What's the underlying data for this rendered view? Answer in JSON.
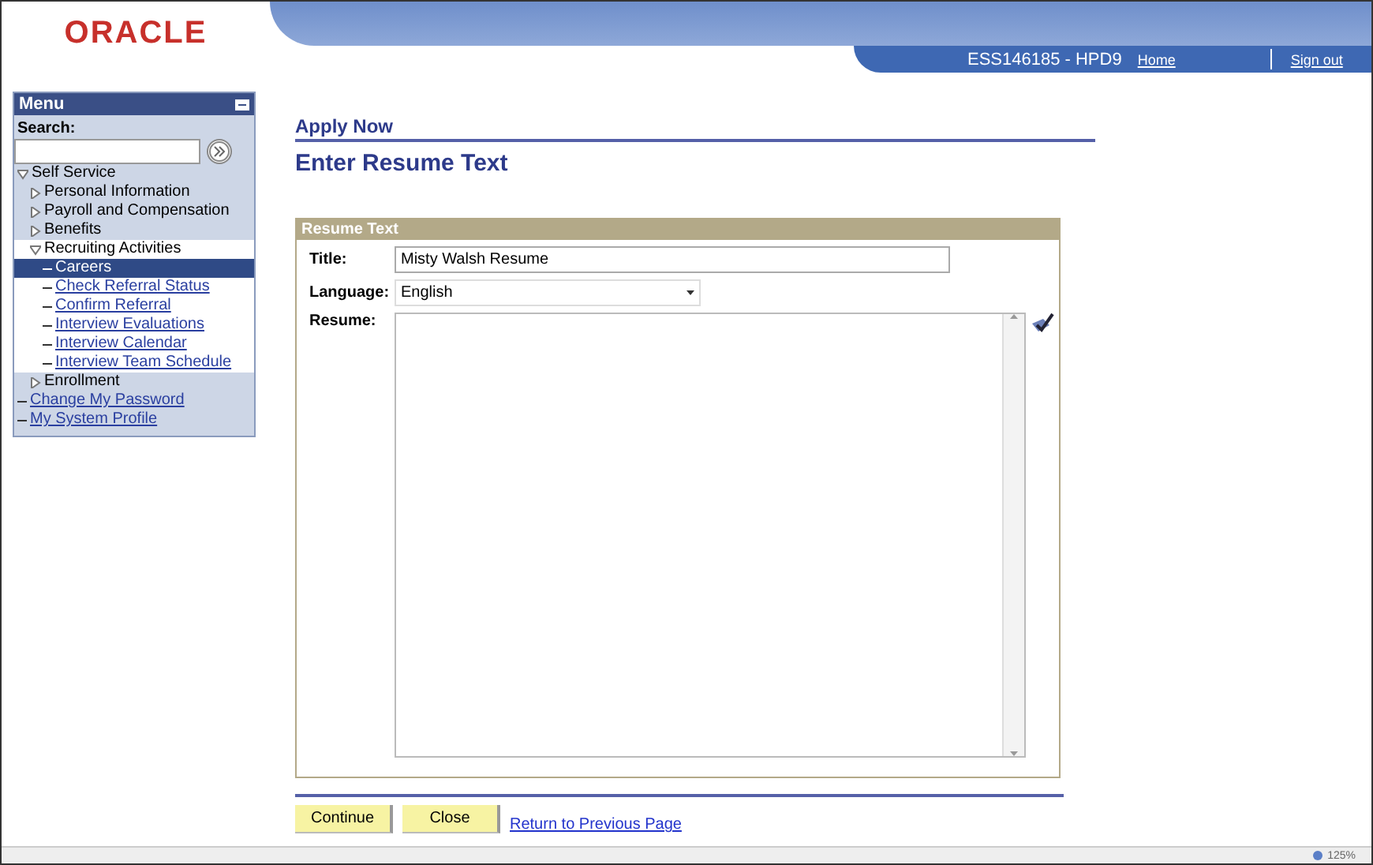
{
  "header": {
    "logo": "ORACLE",
    "server": "ESS146185 - HPD9",
    "links": [
      "Home",
      "Sign out"
    ]
  },
  "menu": {
    "title": "Menu",
    "search_label": "Search:",
    "items": [
      {
        "label": "Self Service",
        "kind": "folder",
        "expanded": true,
        "children": [
          {
            "label": "Personal Information",
            "kind": "folder",
            "expanded": false
          },
          {
            "label": "Payroll and Compensation",
            "kind": "folder",
            "expanded": false
          },
          {
            "label": "Benefits",
            "kind": "folder",
            "expanded": false
          },
          {
            "label": "Recruiting Activities",
            "kind": "folder",
            "expanded": true,
            "children": [
              {
                "label": "Careers",
                "kind": "link",
                "selected": true
              },
              {
                "label": "Check Referral Status",
                "kind": "link",
                "selected": false
              },
              {
                "label": "Confirm Referral",
                "kind": "link",
                "selected": false
              },
              {
                "label": "Interview Evaluations",
                "kind": "link",
                "selected": false
              },
              {
                "label": "Interview Calendar",
                "kind": "link",
                "selected": false
              },
              {
                "label": "Interview Team Schedule",
                "kind": "link",
                "selected": false
              }
            ]
          },
          {
            "label": "Enrollment",
            "kind": "folder",
            "expanded": false
          }
        ]
      },
      {
        "label": "Change My Password",
        "kind": "link",
        "selected": false
      },
      {
        "label": "My System Profile",
        "kind": "link",
        "selected": false
      }
    ]
  },
  "page": {
    "breadcrumb": "Apply Now",
    "title": "Enter Resume Text"
  },
  "panel": {
    "title": "Resume Text",
    "fields": [
      {
        "label": "Title:",
        "kind": "text",
        "value": "Misty Walsh Resume"
      },
      {
        "label": "Language:",
        "kind": "select",
        "value": "English"
      },
      {
        "label": "Resume:",
        "kind": "textarea"
      }
    ]
  },
  "buttons": [
    "Continue",
    "Close"
  ],
  "return_link": "Return to Previous Page",
  "status_bar": {
    "zoom": "125%"
  }
}
